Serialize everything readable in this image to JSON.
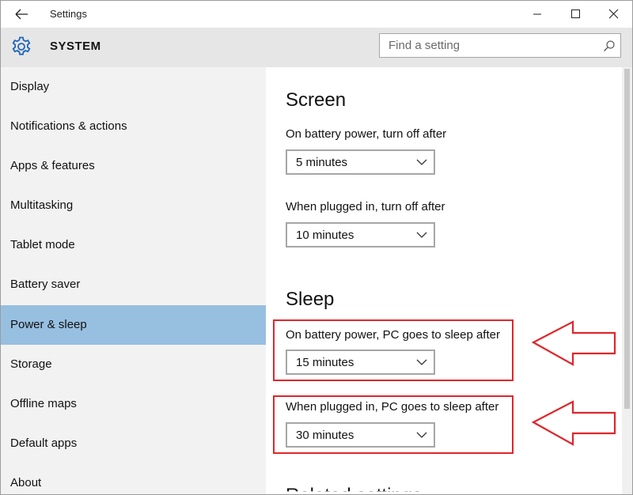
{
  "window": {
    "title": "Settings"
  },
  "header": {
    "title": "SYSTEM",
    "search_placeholder": "Find a setting"
  },
  "sidebar": {
    "items": [
      {
        "label": "Display"
      },
      {
        "label": "Notifications & actions"
      },
      {
        "label": "Apps & features"
      },
      {
        "label": "Multitasking"
      },
      {
        "label": "Tablet mode"
      },
      {
        "label": "Battery saver"
      },
      {
        "label": "Power & sleep"
      },
      {
        "label": "Storage"
      },
      {
        "label": "Offline maps"
      },
      {
        "label": "Default apps"
      },
      {
        "label": "About"
      }
    ],
    "selected": "Power & sleep"
  },
  "screen": {
    "title": "Screen",
    "battery_label": "On battery power, turn off after",
    "battery_value": "5 minutes",
    "plugged_label": "When plugged in, turn off after",
    "plugged_value": "10 minutes"
  },
  "sleep": {
    "title": "Sleep",
    "battery_label": "On battery power, PC goes to sleep after",
    "battery_value": "15 minutes",
    "plugged_label": "When plugged in, PC goes to sleep after",
    "plugged_value": "30 minutes"
  },
  "related": {
    "title": "Related settings"
  },
  "colors": {
    "accent_selected": "#97bfe0",
    "annotation": "#e0262b",
    "header_bg": "#e6e6e6",
    "sidebar_bg": "#f2f2f2"
  },
  "icons": {
    "back": "back-arrow-icon",
    "gear": "gear-icon",
    "search": "search-icon",
    "minimize": "minimize-icon",
    "maximize": "maximize-icon",
    "close": "close-icon",
    "chevron": "chevron-down-icon"
  }
}
